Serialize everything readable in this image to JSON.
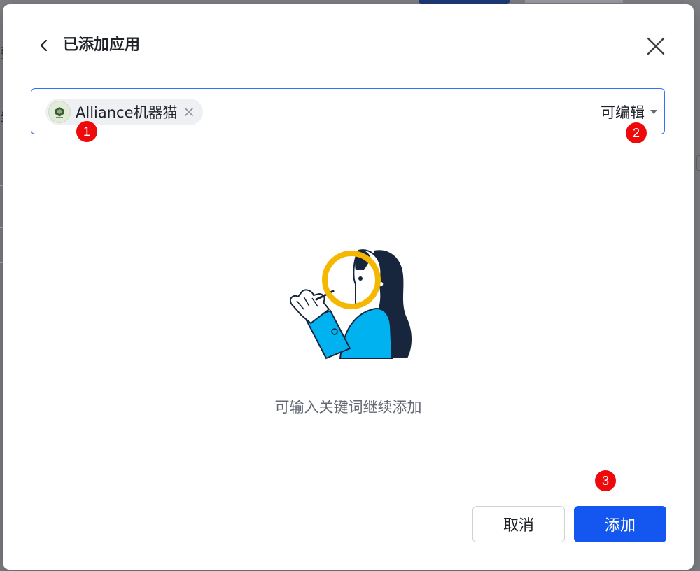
{
  "dialog": {
    "title": "已添加应用",
    "selected_app": {
      "name": "Alliance机器猫",
      "avatar_icon": "alliance-robot-cat-logo"
    },
    "permission": {
      "selected": "可编辑"
    },
    "empty_hint": "可输入关键词继续添加",
    "cancel_label": "取消",
    "add_label": "添加"
  },
  "annotations": {
    "badge1": "1",
    "badge2": "2",
    "badge3": "3"
  },
  "colors": {
    "primary": "#1456f0",
    "focus_border": "#3370ff",
    "badge": "#ee0a0a",
    "illustration_yellow": "#f5b800",
    "illustration_blue": "#00b3f0",
    "illustration_navy": "#17263d"
  }
}
